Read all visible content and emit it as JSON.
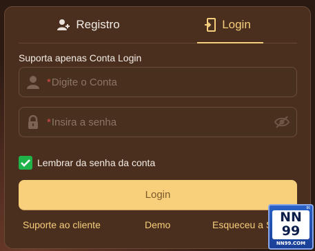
{
  "tabs": [
    {
      "label": "Registro",
      "icon": "add-user-icon",
      "active": false
    },
    {
      "label": "Login",
      "icon": "door-enter-icon",
      "active": true
    }
  ],
  "hint": "Suporta apenas Conta Login",
  "account_field": {
    "required_mark": "*",
    "placeholder": "Digite o Conta",
    "icon": "user-icon"
  },
  "password_field": {
    "required_mark": "*",
    "placeholder": "Insira a senha",
    "icon": "lock-icon",
    "toggle_icon": "eye-slash-icon"
  },
  "remember": {
    "label": "Lembrar da senha da conta",
    "checked": true
  },
  "login_button": "Login",
  "links": {
    "support": "Suporte ao cliente",
    "demo": "Demo",
    "forgot": "Esqueceu a S"
  },
  "logo": {
    "line1": "NN",
    "line2": "99",
    "site": "NN99.COM",
    "tag": "86"
  },
  "colors": {
    "accent": "#f6cf7c",
    "panel": "#4a2e1e",
    "check": "#1fb34a",
    "button": "#f8cf7a"
  }
}
